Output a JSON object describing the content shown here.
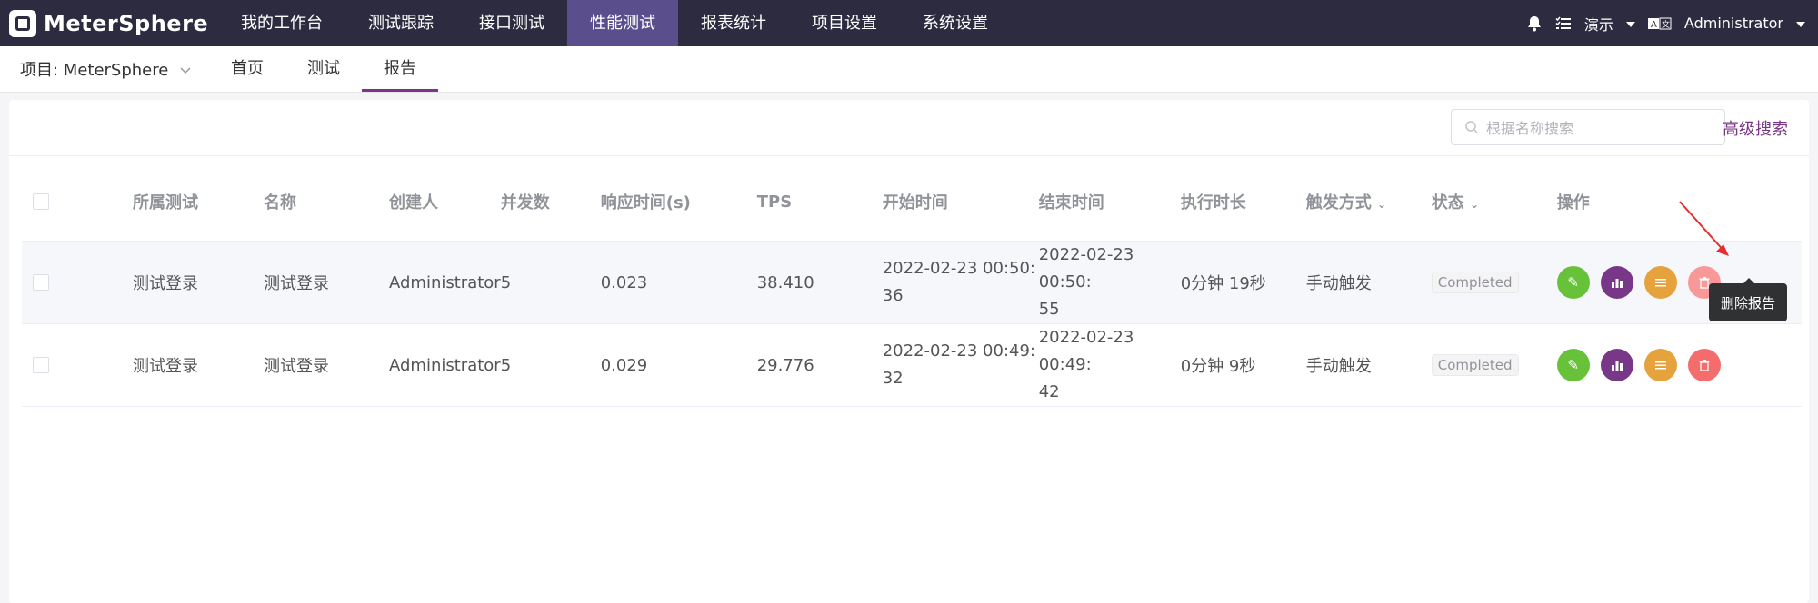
{
  "app": {
    "name": "MeterSphere"
  },
  "nav": {
    "items": [
      "我的工作台",
      "测试跟踪",
      "接口测试",
      "性能测试",
      "报表统计",
      "项目设置",
      "系统设置"
    ],
    "active_index": 3
  },
  "top_right": {
    "lang": "演示",
    "user": "Administrator"
  },
  "subnav": {
    "project_label": "项目: MeterSphere",
    "tabs": [
      "首页",
      "测试",
      "报告"
    ],
    "active_tab": "报告"
  },
  "search": {
    "placeholder": "根据名称搜索",
    "advanced": "高级搜索"
  },
  "table": {
    "headers": [
      "所属测试",
      "名称",
      "创建人",
      "并发数",
      "响应时间(s)",
      "TPS",
      "开始时间",
      "结束时间",
      "执行时长",
      "触发方式",
      "状态",
      "操作"
    ],
    "rows": [
      {
        "test": "测试登录",
        "name": "测试登录",
        "creator": "Administrator",
        "concurrency": "5",
        "response_time": "0.023",
        "tps": "38.410",
        "start_line1": "2022-02-23 00:50:",
        "start_line2": "36",
        "end_line1": "2022-02-23 00:50:",
        "end_line2": "55",
        "duration": "0分钟 19秒",
        "trigger": "手动触发",
        "status": "Completed"
      },
      {
        "test": "测试登录",
        "name": "测试登录",
        "creator": "Administrator",
        "concurrency": "5",
        "response_time": "0.029",
        "tps": "29.776",
        "start_line1": "2022-02-23 00:49:",
        "start_line2": "32",
        "end_line1": "2022-02-23 00:49:",
        "end_line2": "42",
        "duration": "0分钟 9秒",
        "trigger": "手动触发",
        "status": "Completed"
      }
    ]
  },
  "tooltip": {
    "text": "删除报告"
  },
  "colors": {
    "topbar": "#2c2b40",
    "nav_active": "#5a4f8c",
    "accent": "#783887",
    "green": "#67c23a",
    "orange": "#e6a23c",
    "red": "#f56c6c"
  }
}
